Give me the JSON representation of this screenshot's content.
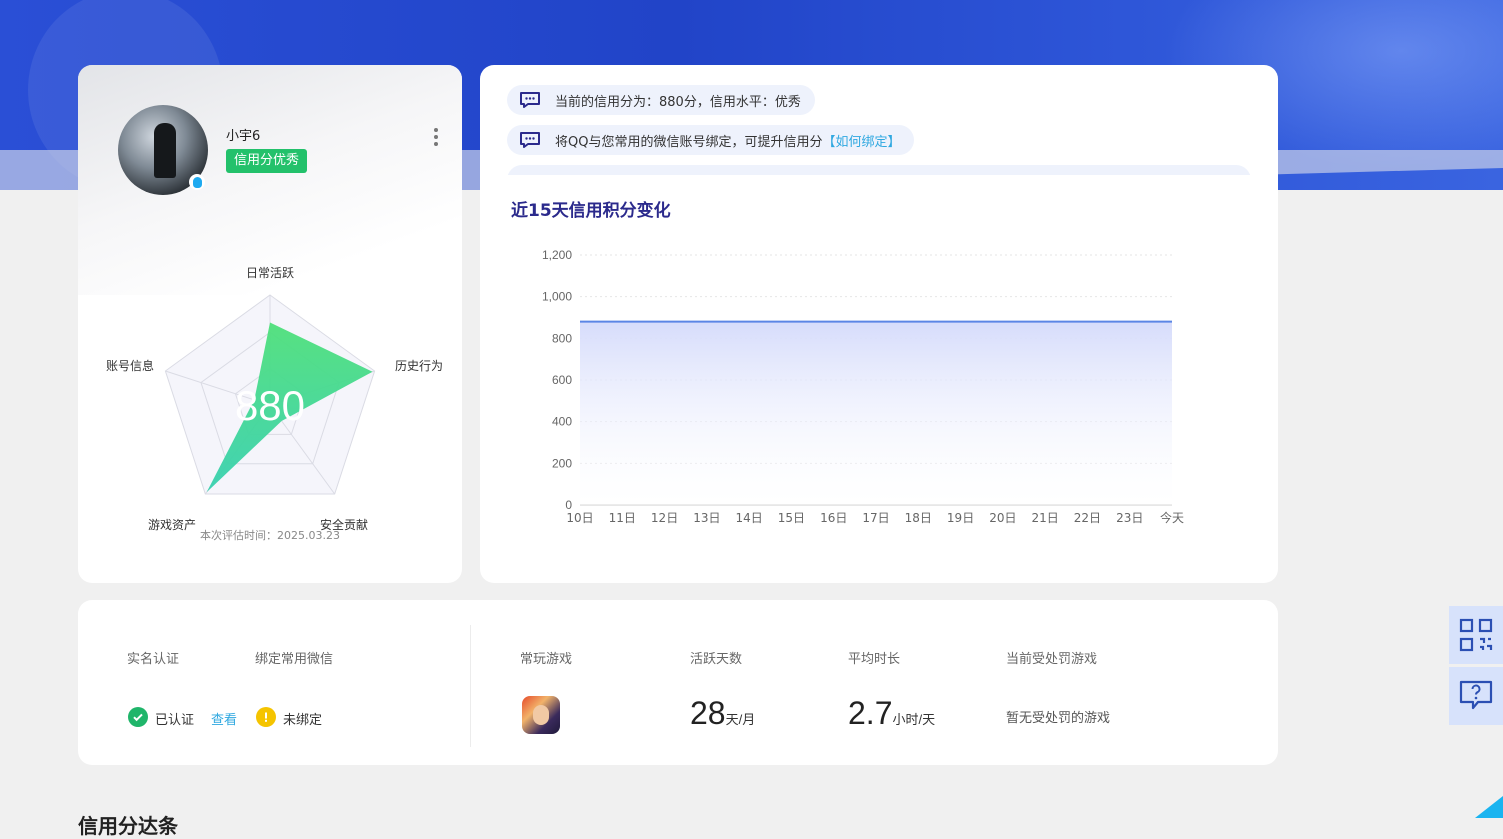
{
  "profile": {
    "username": "小宇6",
    "credit_badge": "信用分优秀",
    "score": "880",
    "radar_axes": [
      "日常活跃",
      "历史行为",
      "安全贡献",
      "游戏资产",
      "账号信息"
    ],
    "radar_values": [
      0.75,
      0.98,
      0.18,
      0.98,
      0.15
    ],
    "eval_time": "本次评估时间：2025.03.23"
  },
  "notices": [
    {
      "text": "当前的信用分为：880分，信用水平：优秀",
      "link": ""
    },
    {
      "text": "将QQ与您常用的微信账号绑定，可提升信用分",
      "link": "【如何绑定】"
    }
  ],
  "chart_title": "近15天信用积分变化",
  "chart_data": {
    "type": "area",
    "categories": [
      "10日",
      "11日",
      "12日",
      "13日",
      "14日",
      "15日",
      "16日",
      "17日",
      "18日",
      "19日",
      "20日",
      "21日",
      "22日",
      "23日",
      "今天"
    ],
    "values": [
      880,
      880,
      880,
      880,
      880,
      880,
      880,
      880,
      880,
      880,
      880,
      880,
      880,
      880,
      880
    ],
    "ylim": [
      0,
      1200
    ],
    "yticks": [
      "0",
      "200",
      "400",
      "600",
      "800",
      "1,000",
      "1,200"
    ],
    "color": "#5b86e5"
  },
  "info": {
    "realname_label": "实名认证",
    "realname_value": "已认证",
    "realname_link": "查看",
    "wechat_label": "绑定常用微信",
    "wechat_value": "未绑定",
    "games_label": "常玩游戏",
    "active_label": "活跃天数",
    "active_value": "28",
    "active_unit": "天/月",
    "avg_label": "平均时长",
    "avg_value": "2.7",
    "avg_unit": "小时/天",
    "penalty_label": "当前受处罚游戏",
    "penalty_value": "暂无受处罚的游戏"
  },
  "bottom_title": "信用分达条",
  "icons": {
    "qr": "qr-code-icon",
    "help": "help-chat-icon"
  }
}
